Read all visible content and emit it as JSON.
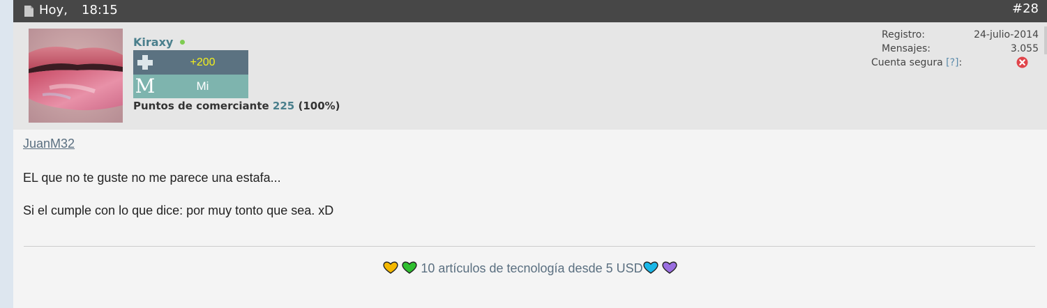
{
  "post": {
    "date": "Hoy,",
    "time": "18:15",
    "number": "#28"
  },
  "user": {
    "name": "Kiraxy",
    "online": true,
    "reputation": "+200",
    "rank_letter": "M",
    "rank_title": "Mi",
    "merchant_label": "Puntos de comerciante",
    "merchant_points": "225",
    "merchant_percent": "(100%)"
  },
  "stats": {
    "registro_label": "Registro:",
    "registro_value": "24-julio-2014",
    "mensajes_label": "Mensajes:",
    "mensajes_value": "3.055",
    "cuenta_label": "Cuenta segura",
    "cuenta_help": "[?]",
    "cuenta_colon": ":"
  },
  "message": {
    "quote_user": "JuanM32",
    "lines": [
      "EL que no te guste no me parece una estafa...",
      "Si el cumple con lo que dice: por muy tonto que sea. xD"
    ]
  },
  "signature": {
    "text": "10 artículos de tecnología desde 5 USD",
    "hearts": [
      "#f5b800",
      "#2fbf2f",
      "#1ab7e8",
      "#9a6ee0"
    ]
  },
  "colors": {
    "header_bg": "#474747",
    "accent": "#4a7f8c",
    "rep_bg": "#5b7281",
    "rank_bg": "#7eb4ae"
  }
}
